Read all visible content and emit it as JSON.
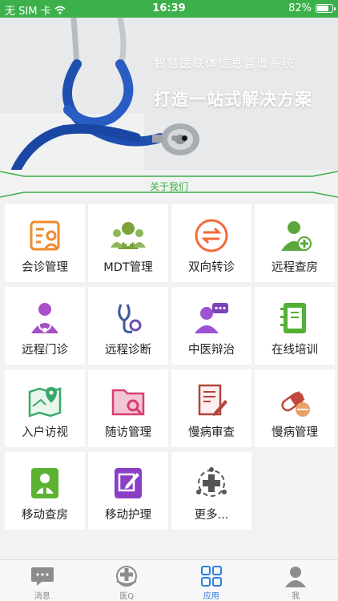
{
  "status_bar": {
    "carrier": "无 SIM 卡",
    "time": "16:39",
    "battery": "82%",
    "battery_level": 0.82
  },
  "banner": {
    "subtitle": "智慧医联体信息管理系统",
    "title": "打造一站式解决方案"
  },
  "section": {
    "about_label": "关于我们"
  },
  "apps": [
    {
      "label": "会诊管理",
      "icon": "consultation-form-icon",
      "color": "#f08a2e"
    },
    {
      "label": "MDT管理",
      "icon": "mdt-team-icon",
      "color": "#7aa43a"
    },
    {
      "label": "双向转诊",
      "icon": "two-way-arrows-icon",
      "color": "#f26b3a"
    },
    {
      "label": "远程查房",
      "icon": "doctor-plus-icon",
      "color": "#5aa83b"
    },
    {
      "label": "远程门诊",
      "icon": "doctor-stethoscope-icon",
      "color": "#a64fc6"
    },
    {
      "label": "远程诊断",
      "icon": "stethoscope-icon",
      "color": "#3d5a9e"
    },
    {
      "label": "中医辩治",
      "icon": "person-chat-icon",
      "color": "#9b52d3"
    },
    {
      "label": "在线培训",
      "icon": "notebook-icon",
      "color": "#52b035"
    },
    {
      "label": "入户访视",
      "icon": "map-pin-icon",
      "color": "#3aa86a"
    },
    {
      "label": "随访管理",
      "icon": "folder-search-icon",
      "color": "#d83d72"
    },
    {
      "label": "慢病审查",
      "icon": "document-pen-icon",
      "color": "#b1453b"
    },
    {
      "label": "慢病管理",
      "icon": "pills-icon",
      "color": "#c2483c"
    },
    {
      "label": "移动查房",
      "icon": "mobile-doctor-icon",
      "color": "#5cb233"
    },
    {
      "label": "移动护理",
      "icon": "edit-square-icon",
      "color": "#8a3fc4"
    },
    {
      "label": "更多...",
      "icon": "more-plus-icon",
      "color": "#555555"
    }
  ],
  "tabs": [
    {
      "label": "消息",
      "icon": "message-icon",
      "active": false
    },
    {
      "label": "医Q",
      "icon": "medical-q-icon",
      "active": false
    },
    {
      "label": "应用",
      "icon": "apps-grid-icon",
      "active": true
    },
    {
      "label": "我",
      "icon": "profile-icon",
      "active": false
    }
  ],
  "colors": {
    "brand_green": "#3cb04a",
    "tab_active": "#2d7ee6",
    "tab_inactive": "#888888"
  }
}
